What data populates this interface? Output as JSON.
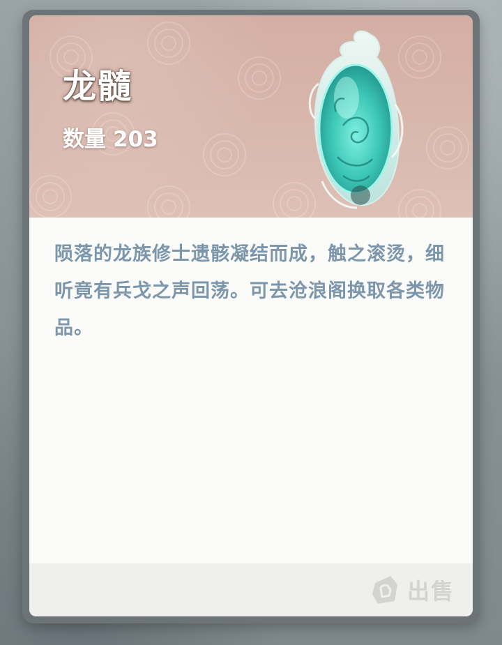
{
  "item": {
    "name": "龙髓",
    "quantity_label": "数量",
    "quantity_value": "203",
    "icon": "jade-dragon-pendant",
    "description": "陨落的龙族修士遗骸凝结而成，触之滚烫，细听竟有兵戈之声回荡。可去沧浪阁换取各类物品。"
  },
  "actions": {
    "sell_label": "出售",
    "sell_icon": "sell-tag-icon"
  },
  "colors": {
    "header_bg": "#d9b8ae",
    "description_text": "#7c96ab",
    "sell_disabled": "#d3d3d1",
    "jade": "#5fd6c8"
  }
}
